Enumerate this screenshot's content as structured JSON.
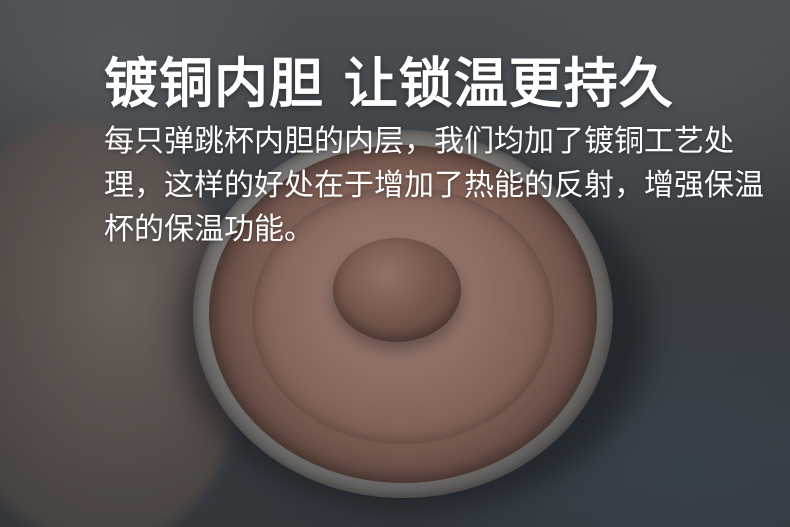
{
  "headline": "镀铜内胆  让锁温更持久",
  "description": "每只弹跳杯内胆的内层，我们均加了镀铜工艺处理，这样的好处在于增加了热能的反射，增强保温杯的保温功能。"
}
